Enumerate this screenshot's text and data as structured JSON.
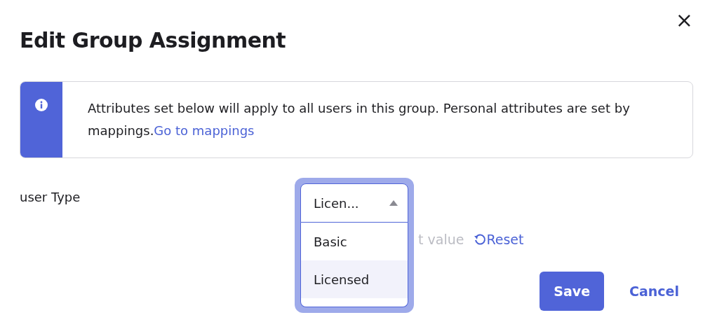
{
  "dialog": {
    "title": "Edit Group Assignment",
    "close": "×"
  },
  "notice": {
    "text": "Attributes set below will apply to all users in this group. Personal attributes are set by mappings.",
    "link": "Go to mappings"
  },
  "field": {
    "label": "user Type",
    "value": "Licen...",
    "expanded": true,
    "hint": "t value",
    "reset": "Reset",
    "options": [
      {
        "label": "Basic",
        "selected": false
      },
      {
        "label": "Licensed",
        "selected": true
      }
    ]
  },
  "buttons": {
    "save": "Save",
    "cancel": "Cancel"
  }
}
